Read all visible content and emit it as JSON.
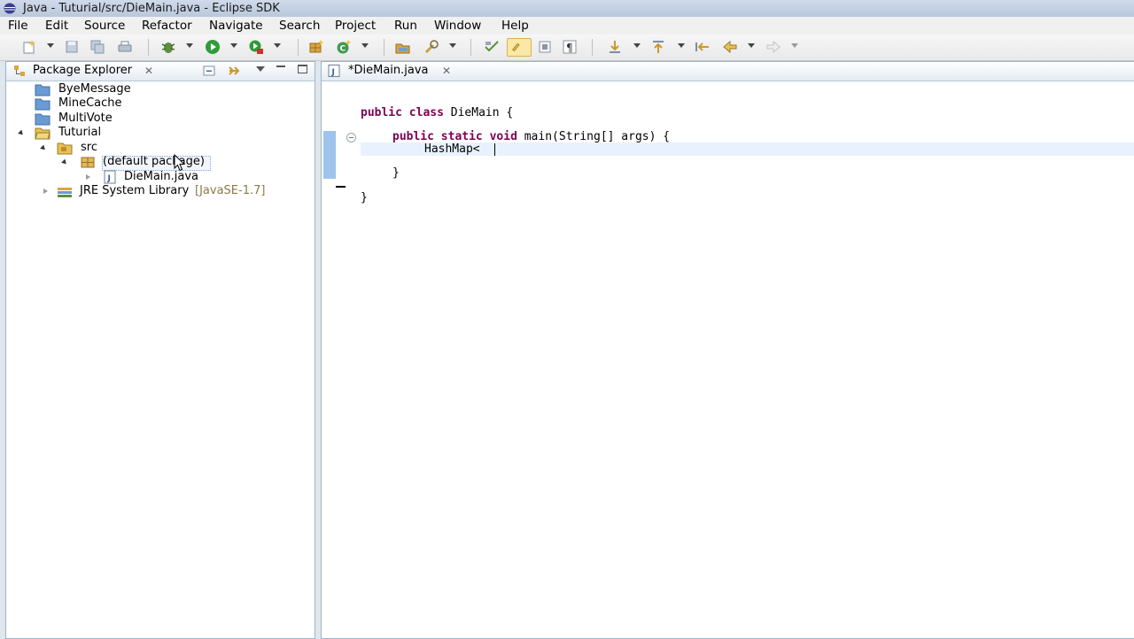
{
  "window": {
    "title": "Java - Tuturial/src/DieMain.java - Eclipse SDK"
  },
  "menu": {
    "items": [
      "File",
      "Edit",
      "Source",
      "Refactor",
      "Navigate",
      "Search",
      "Project",
      "Run",
      "Window",
      "Help"
    ]
  },
  "toolbar": {
    "icons": [
      "new-icon",
      "save-icon",
      "save-all-icon",
      "print-icon",
      "debug-icon",
      "run-icon",
      "external-tools-icon",
      "new-java-package-icon",
      "new-java-class-icon",
      "open-type-icon",
      "search-icon",
      "toggle-mark-occurrences-icon",
      "toggle-highlight-icon",
      "show-whitespace-icon",
      "next-annotation-icon",
      "previous-annotation-icon",
      "last-edit-location-icon",
      "back-icon",
      "forward-icon"
    ]
  },
  "explorer": {
    "title": "Package Explorer",
    "close": "✕",
    "tree": [
      {
        "label": "ByeMessage"
      },
      {
        "label": "MineCache"
      },
      {
        "label": "MultiVote"
      },
      {
        "label": "Tuturial"
      },
      {
        "label": "src"
      },
      {
        "label": "(default package)"
      },
      {
        "label": "DieMain.java"
      },
      {
        "label": "JRE System Library",
        "extra": "[JavaSE-1.7]"
      }
    ]
  },
  "editor": {
    "tab_label": "*DieMain.java",
    "tab_close": "✕",
    "code": {
      "line1_kw1": "public",
      "line1_kw2": "class",
      "line1_rest": " DieMain {",
      "line2_kw1": "public",
      "line2_kw2": "static",
      "line2_kw3": "void",
      "line2_rest": " main(String[] args) {",
      "line3_text": "HashMap<",
      "line4_text": "}",
      "line5_text": "}"
    }
  },
  "colors": {
    "keyword": "#7f0055",
    "current_line": "#e8f2fe",
    "selection_range": "#9ec4ec"
  }
}
